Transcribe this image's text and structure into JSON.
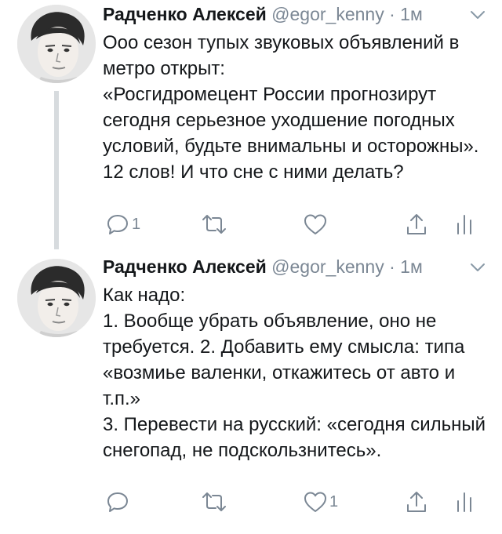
{
  "tweets": [
    {
      "author_name": "Радченко Алексей",
      "handle": "@egor_kenny",
      "separator": "·",
      "time": "1м",
      "paragraphs": [
        "Ооо сезон тупых звуковых объявлений в метро открыт:",
        "«Росгидромецент России прогнозирут сегодня серьезное уходшение погодных условий, будьте внимальны и осторожны».",
        "12 слов! И что сне с ними делать?"
      ],
      "reply_count": "1",
      "retweet_count": "",
      "like_count": ""
    },
    {
      "author_name": "Радченко Алексей",
      "handle": "@egor_kenny",
      "separator": "·",
      "time": "1м",
      "paragraphs": [
        "Как надо:",
        "1. Вообще убрать объявление, оно не требуется. 2. Добавить ему смысла: типа «возмиье валенки, откажитесь от авто и т.п.»",
        "3. Перевести на русский: «сегодня сильный снегопад, не подскользнитесь»."
      ],
      "reply_count": "",
      "retweet_count": "",
      "like_count": "1"
    }
  ],
  "icons": {
    "reply": "reply-icon",
    "retweet": "retweet-icon",
    "like": "heart-icon",
    "share": "share-icon",
    "stats": "stats-icon",
    "menu": "chevron-down-icon"
  },
  "colors": {
    "text": "#14171a",
    "secondary": "#7b8794",
    "thread_line": "#d7dbde"
  }
}
